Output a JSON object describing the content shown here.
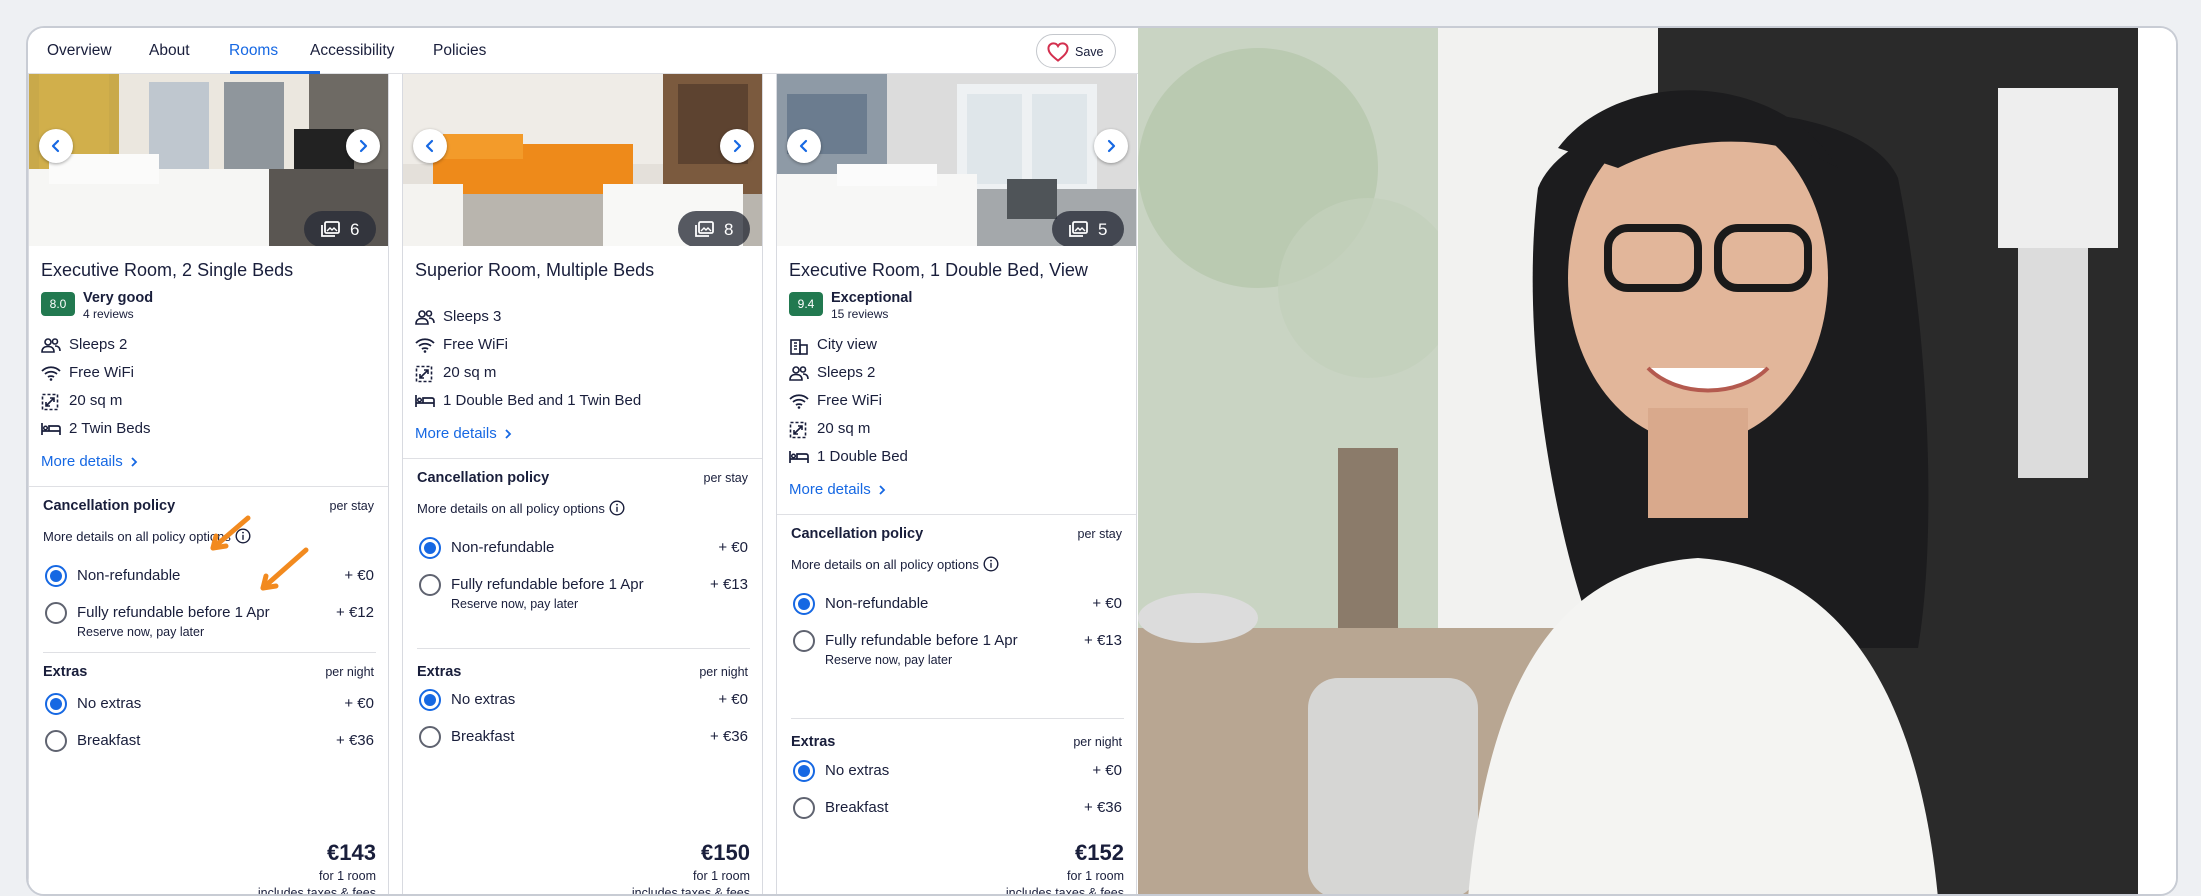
{
  "tabs": [
    {
      "label": "Overview"
    },
    {
      "label": "About"
    },
    {
      "label": "Rooms"
    },
    {
      "label": "Accessibility"
    },
    {
      "label": "Policies"
    }
  ],
  "active_tab": "Rooms",
  "save_label": "Save",
  "rooms": [
    {
      "photo_count": "6",
      "title": "Executive Room, 2 Single Beds",
      "score": "8.0",
      "score_label": "Very good",
      "reviews": "4 reviews",
      "features": [
        "Sleeps 2",
        "Free WiFi",
        "20 sq m",
        "2 Twin Beds"
      ],
      "more_details": "More details",
      "cancellation_title": "Cancellation policy",
      "cancellation_unit": "per stay",
      "policy_note": "More details on all policy options",
      "options": [
        {
          "label": "Non-refundable",
          "price": "+ €0",
          "selected": true
        },
        {
          "label": "Fully refundable before 1 Apr",
          "sub": "Reserve now, pay later",
          "price": "+ €12",
          "selected": false
        }
      ],
      "extras_title": "Extras",
      "extras_unit": "per night",
      "extras": [
        {
          "label": "No extras",
          "price": "+ €0",
          "selected": true
        },
        {
          "label": "Breakfast",
          "price": "+ €36",
          "selected": false
        }
      ],
      "price": "€143",
      "price_for": "for 1 room",
      "price_tax": "includes taxes & fees"
    },
    {
      "photo_count": "8",
      "title": "Superior Room, Multiple Beds",
      "features": [
        "Sleeps 3",
        "Free WiFi",
        "20 sq m",
        "1 Double Bed and 1 Twin Bed"
      ],
      "more_details": "More details",
      "cancellation_title": "Cancellation policy",
      "cancellation_unit": "per stay",
      "policy_note": "More details on all policy options",
      "options": [
        {
          "label": "Non-refundable",
          "price": "+ €0",
          "selected": true
        },
        {
          "label": "Fully refundable before 1 Apr",
          "sub": "Reserve now, pay later",
          "price": "+ €13",
          "selected": false
        }
      ],
      "extras_title": "Extras",
      "extras_unit": "per night",
      "extras": [
        {
          "label": "No extras",
          "price": "+ €0",
          "selected": true
        },
        {
          "label": "Breakfast",
          "price": "+ €36",
          "selected": false
        }
      ],
      "price": "€150",
      "price_for": "for 1 room",
      "price_tax": "includes taxes & fees"
    },
    {
      "photo_count": "5",
      "title": "Executive Room, 1 Double Bed, View",
      "score": "9.4",
      "score_label": "Exceptional",
      "reviews": "15 reviews",
      "features": [
        "City view",
        "Sleeps 2",
        "Free WiFi",
        "20 sq m",
        "1 Double Bed"
      ],
      "more_details": "More details",
      "cancellation_title": "Cancellation policy",
      "cancellation_unit": "per stay",
      "policy_note": "More details on all policy options",
      "options": [
        {
          "label": "Non-refundable",
          "price": "+ €0",
          "selected": true
        },
        {
          "label": "Fully refundable before 1 Apr",
          "sub": "Reserve now, pay later",
          "price": "+ €13",
          "selected": false
        }
      ],
      "extras_title": "Extras",
      "extras_unit": "per night",
      "extras": [
        {
          "label": "No extras",
          "price": "+ €0",
          "selected": true
        },
        {
          "label": "Breakfast",
          "price": "+ €36",
          "selected": false
        }
      ],
      "price": "€152",
      "price_for": "for 1 room",
      "price_tax": "includes taxes & fees"
    }
  ],
  "colors": {
    "accent": "#1668e3",
    "score_badge": "#227950",
    "annotation_arrow": "#f28a1f",
    "text": "#191e3b"
  }
}
